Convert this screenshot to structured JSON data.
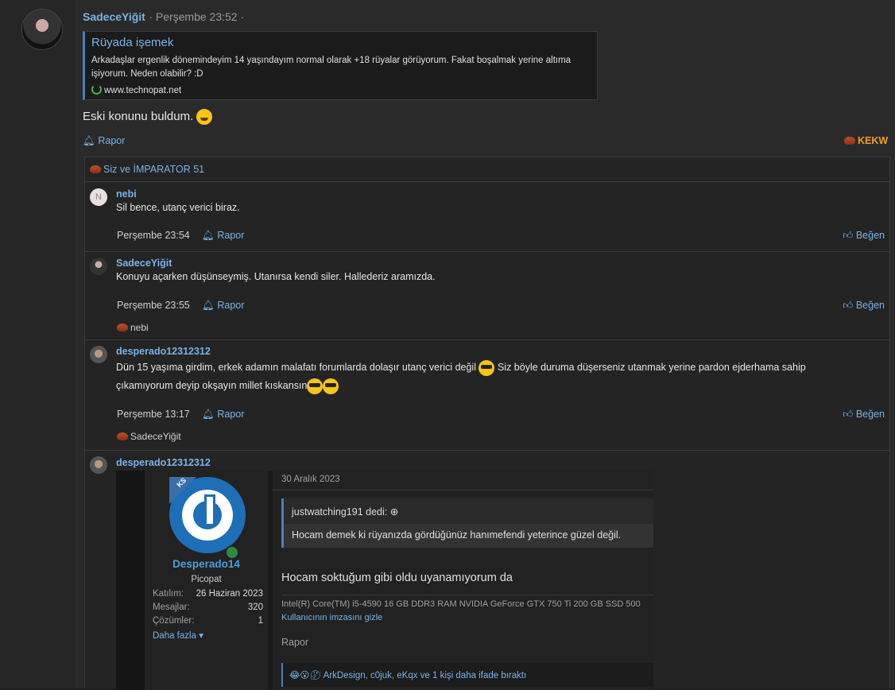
{
  "post": {
    "username": "SadeceYiğit",
    "time": "· Perşembe 23:52 ·",
    "quote": {
      "title": "Rüyada işemek",
      "body": "Arkadaşlar ergenlik dönemindeyim 14 yaşındayım normal olarak +18 rüyalar görüyorum. Fakat boşalmak yerine altıma işiyorum. Neden olabilir? :D",
      "source": "www.technopat.net"
    },
    "text": "Eski konunu buldum.",
    "report_label": "Rapor",
    "reaction_label": "KEKW",
    "reacted_by": "Siz ve İMPARATOR 51"
  },
  "comments": [
    {
      "username": "nebi",
      "avatar_letter": "N",
      "text": "Sil bence, utanç verici biraz.",
      "time": "Perşembe 23:54",
      "report": "Rapor",
      "like": "Beğen"
    },
    {
      "username": "SadeceYiğit",
      "text": "Konuyu açarken düşünseymiş. Utanırsa kendi siler. Hallederiz aramızda.",
      "time": "Perşembe 23:55",
      "report": "Rapor",
      "like": "Beğen",
      "reacted_by": "nebi"
    },
    {
      "username": "desperado12312312",
      "text_part1": "Dün 15 yaşıma girdim, erkek adamın malafatı forumlarda dolaşır utanç verici değil",
      "text_part2": "Siz böyle duruma düşerseniz utanmak yerine pardon ejderhama sahip",
      "text_line2": "çıkamıyorum deyip okşayın millet kıskansın",
      "time": "Perşembe 13:17",
      "report": "Rapor",
      "like": "Beğen",
      "reacted_by": "SadeceYiğit"
    },
    {
      "username": "desperado12312312"
    }
  ],
  "embed": {
    "badge": "KS",
    "username": "Desperado14",
    "title": "Picopat",
    "stats": [
      {
        "label": "Katılım:",
        "value": "26 Haziran 2023"
      },
      {
        "label": "Mesajlar:",
        "value": "320"
      },
      {
        "label": "Çözümler:",
        "value": "1"
      }
    ],
    "more_label": "Daha fazla",
    "date": "30 Aralık 2023",
    "quote_author": "justwatching191 dedi:",
    "quote_text": "Hocam demek ki rüyanızda gördüğünüz hanımefendi yeterince güzel değil.",
    "message": "Hocam soktuğum gibi oldu uyanamıyorum da",
    "signature": "Intel(R) Core(TM) i5-4590 16 GB DDR3 RAM NVIDIA GeForce GTX 750 Ti 200 GB SSD 500",
    "hide_signature": "Kullanıcının imzasını gizle",
    "report": "Rapor",
    "reactions_text": "ArkDesign, c0juk, eKqx ve 1 kişi daha ifade bıraktı"
  }
}
